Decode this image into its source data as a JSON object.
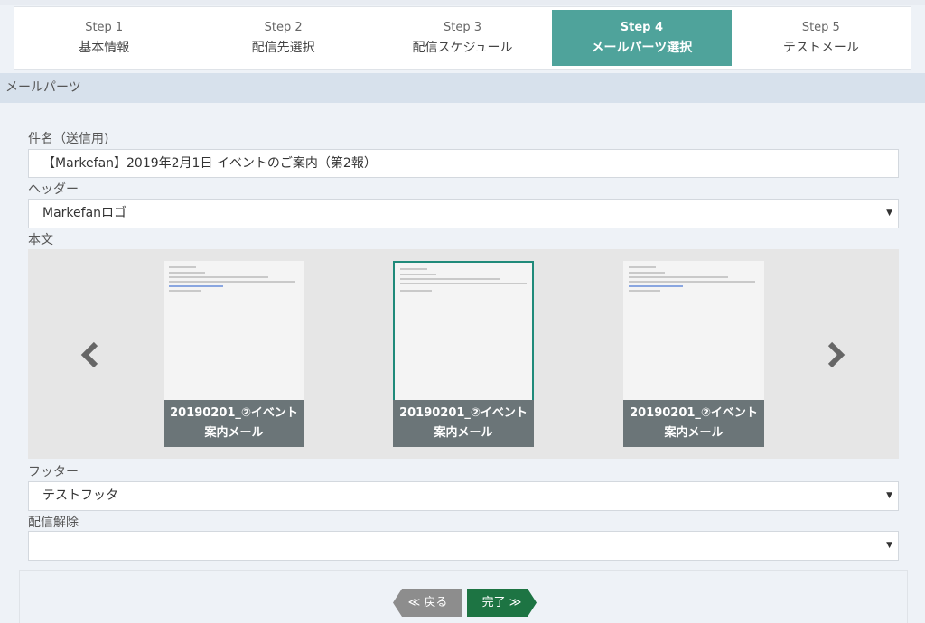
{
  "stepper": {
    "steps": [
      {
        "num": "Step 1",
        "label": "基本情報"
      },
      {
        "num": "Step 2",
        "label": "配信先選択"
      },
      {
        "num": "Step 3",
        "label": "配信スケジュール"
      },
      {
        "num": "Step 4",
        "label": "メールパーツ選択"
      },
      {
        "num": "Step 5",
        "label": "テストメール"
      }
    ],
    "active_index": 3,
    "active_color": "#4fa39b"
  },
  "section": {
    "title": "メールパーツ"
  },
  "subject": {
    "label": "件名（送信用)",
    "value": "【Markefan】2019年2月1日 イベントのご案内（第2報）"
  },
  "header": {
    "label": "ヘッダー",
    "value": "Markefanロゴ"
  },
  "body": {
    "label": "本文",
    "cards": [
      {
        "title_line1": "20190201_②イベント",
        "title_line2": "案内メール",
        "selected": false
      },
      {
        "title_line1": "20190201_②イベント",
        "title_line2": "案内メール",
        "selected": true
      },
      {
        "title_line1": "20190201_②イベント",
        "title_line2": "案内メール",
        "selected": false
      }
    ],
    "prev_icon": "chevron-left-icon",
    "next_icon": "chevron-right-icon"
  },
  "footer": {
    "label": "フッター",
    "value": "テストフッタ"
  },
  "unsubscribe": {
    "label": "配信解除",
    "value": ""
  },
  "actions": {
    "back_label": "≪ 戻る",
    "done_label": "完了 ≫",
    "back_color": "#8d8d8d",
    "done_color": "#1d7443"
  }
}
